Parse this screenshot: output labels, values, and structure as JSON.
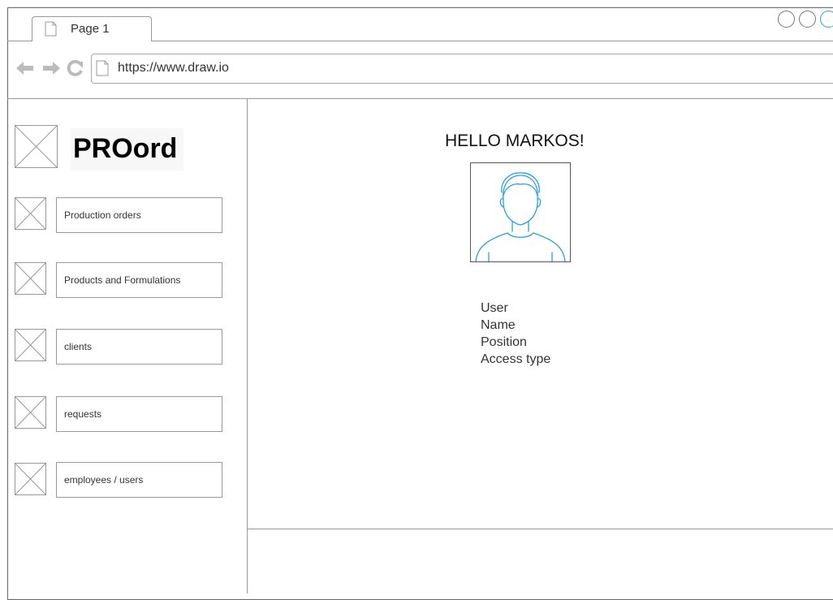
{
  "browser": {
    "tab_title": "Page 1",
    "url": "https://www.draw.io"
  },
  "sidebar": {
    "logo": "PROord",
    "items": [
      {
        "label": "Production orders"
      },
      {
        "label": "Products and Formulations"
      },
      {
        "label": "clients"
      },
      {
        "label": "requests"
      },
      {
        "label": "employees / users"
      }
    ]
  },
  "main": {
    "greeting": "HELLO  MARKOS!",
    "profile_fields": [
      "User",
      "Name",
      "Position",
      "Access type"
    ]
  },
  "colors": {
    "avatar_stroke": "#29a0e6",
    "accent_control": "#29a0e6"
  }
}
